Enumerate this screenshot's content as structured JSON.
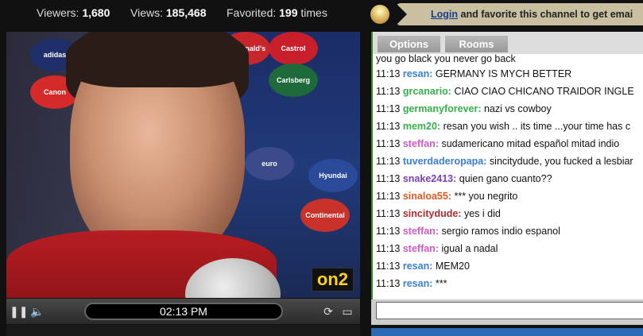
{
  "stats": {
    "viewers_label": "Viewers:",
    "viewers_value": "1,680",
    "views_label": "Views:",
    "views_value": "185,468",
    "favorited_label": "Favorited:",
    "favorited_value": "199",
    "favorited_suffix": "times"
  },
  "promo": {
    "link": "Login",
    "text": "and favorite this channel to get emai"
  },
  "video": {
    "watermark": "on2",
    "time": "02:13 PM",
    "sponsors": [
      "adidas",
      "Castrol",
      "Canon",
      "Carlsberg",
      "euro",
      "Continental",
      "Hyundai",
      "McDonald's"
    ]
  },
  "chat": {
    "tabs": [
      "Options",
      "Rooms"
    ],
    "partial_line": "you go black you never go back",
    "messages": [
      {
        "time": "11:13",
        "user": "resan:",
        "text": "GERMANY IS MYCH BETTER",
        "color": "#3a7fd0"
      },
      {
        "time": "11:13",
        "user": "grcanario:",
        "text": "CIAO CIAO CHICANO TRAIDOR INGLE",
        "color": "#35b24a"
      },
      {
        "time": "11:13",
        "user": "germanyforever:",
        "text": "nazi vs cowboy",
        "color": "#35b24a"
      },
      {
        "time": "11:13",
        "user": "mem20:",
        "text": "resan you wish .. its time ...your time has c",
        "color": "#35b24a"
      },
      {
        "time": "11:13",
        "user": "steffan:",
        "text": "sudamericano mitad español mitad indio",
        "color": "#d05ac8"
      },
      {
        "time": "11:13",
        "user": "tuverdaderopapa:",
        "text": "sincitydude, you fucked a lesbiar",
        "color": "#3a7fd0"
      },
      {
        "time": "11:13",
        "user": "snake2413:",
        "text": "quien gano cuanto??",
        "color": "#7a3fc0"
      },
      {
        "time": "11:13",
        "user": "sinaloa55:",
        "text": "*** you negrito",
        "color": "#e05a20"
      },
      {
        "time": "11:13",
        "user": "sincitydude:",
        "text": "yes i did",
        "color": "#b02a30"
      },
      {
        "time": "11:13",
        "user": "steffan:",
        "text": "sergio ramos indio espanol",
        "color": "#d05ac8"
      },
      {
        "time": "11:13",
        "user": "steffan:",
        "text": "igual a nadal",
        "color": "#d05ac8"
      },
      {
        "time": "11:13",
        "user": "resan:",
        "text": "MEM20",
        "color": "#3a7fd0"
      },
      {
        "time": "11:13",
        "user": "resan:",
        "text": "***",
        "color": "#3a7fd0"
      }
    ]
  }
}
